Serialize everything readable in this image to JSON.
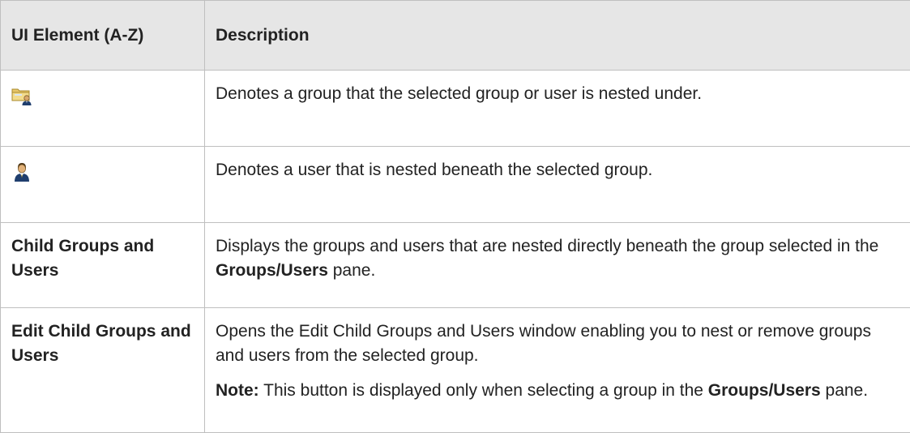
{
  "header": {
    "col_element": "UI Element (A-Z)",
    "col_description": "Description"
  },
  "rows": [
    {
      "icon": "nested-group-icon",
      "description": "Denotes a group that the selected group or user is nested under."
    },
    {
      "icon": "user-icon",
      "description": "Denotes a user that is nested beneath the selected group."
    },
    {
      "element": "Child Groups and Users",
      "desc_before": "Displays the groups and users that are nested directly beneath the group selected in the ",
      "desc_bold": "Groups/Users",
      "desc_after": " pane."
    },
    {
      "element": "Edit Child Groups and Users",
      "description": "Opens the Edit Child Groups and Users window enabling you to nest or remove groups and users from the selected group.",
      "note_label": "Note:",
      "note_text": " This button is displayed only when selecting a group in the ",
      "note_bold": "Groups/Users",
      "note_after": " pane."
    }
  ],
  "colors": {
    "header_bg": "#e6e6e6",
    "border": "#bfbfbf",
    "text": "#222222"
  }
}
